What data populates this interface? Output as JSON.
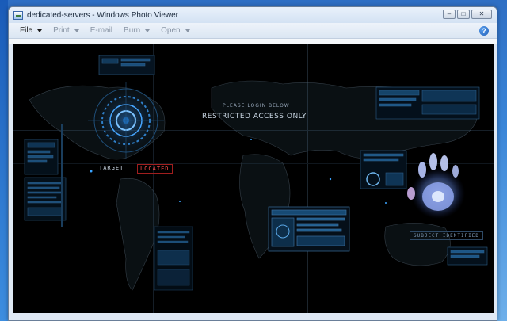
{
  "window": {
    "title": "dedicated-servers - Windows Photo Viewer",
    "minimize": "–",
    "maximize": "□",
    "close": "✕"
  },
  "menu": {
    "file": "File",
    "print": "Print",
    "email": "E-mail",
    "burn": "Burn",
    "open": "Open",
    "help": "?"
  },
  "image": {
    "login_prompt": "PLEASE LOGIN BELOW",
    "restricted": "RESTRICTED ACCESS ONLY",
    "target": "TARGET",
    "located": "LOCATED",
    "subject": "SUBJECT IDENTIFIED"
  },
  "colors": {
    "accent_blue": "#3aa3ff",
    "alert_red": "#ff4d4d"
  }
}
